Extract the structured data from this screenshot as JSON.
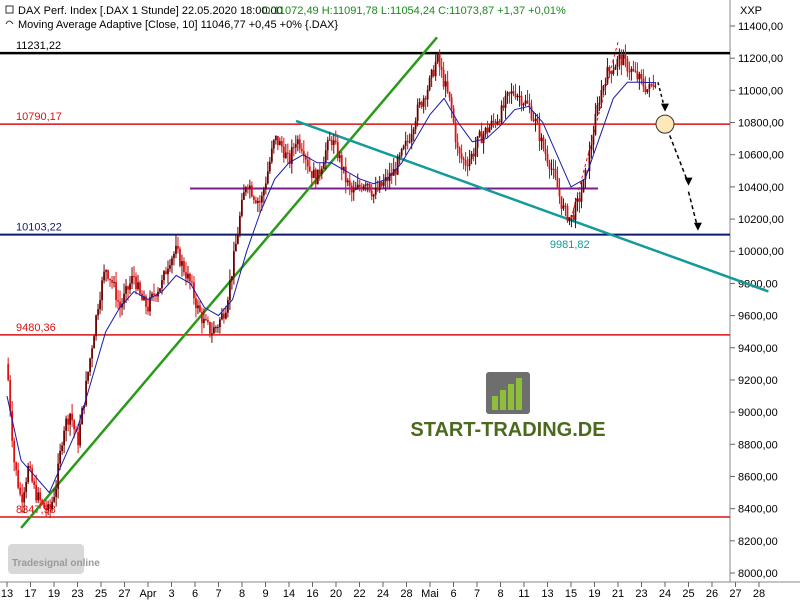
{
  "header": {
    "instrument": "DAX Perf. Index [.DAX  1 Stunde] 22.05.2020 18:00:00",
    "ohlc": "O:11072,49 H:11091,78 L:11054,24 C:11073,87 +1,37 +0,01%",
    "ma_label": "Moving Average Adaptive [Close, 10] 11046,77 +0,45 +0% {.DAX}",
    "axis_code": "XXP"
  },
  "watermark": {
    "brand": "START-TRADING.DE",
    "logo_text": "Tradesignal online"
  },
  "colors": {
    "candle_up": "#6b0000",
    "candle_down": "#e01010",
    "moving_average": "#1a1aa8",
    "resistance": "#000000",
    "red_level": "#dd1111",
    "purple_level": "#7a1d8a",
    "navy_level": "#0d1b6e",
    "uptrend": "#2a9a1a",
    "downtrend": "#139a9a",
    "brand_text": "#4b6a1e"
  },
  "chart_data": {
    "type": "candlestick",
    "y_axis": {
      "ylim": [
        7950,
        11550
      ],
      "ticks": [
        "8000,00",
        "8200,00",
        "8400,00",
        "8600,00",
        "8800,00",
        "9000,00",
        "9200,00",
        "9400,00",
        "9600,00",
        "9800,00",
        "10000,00",
        "10200,00",
        "10400,00",
        "10600,00",
        "10800,00",
        "11000,00",
        "11200,00",
        "11400,00"
      ]
    },
    "x_axis": {
      "tick_labels": [
        "13",
        "17",
        "19",
        "23",
        "25",
        "27",
        "Apr",
        "3",
        "6",
        "7",
        "8",
        "9",
        "14",
        "16",
        "20",
        "22",
        "24",
        "28",
        "Mai",
        "6",
        "7",
        "8",
        "11",
        "13",
        "15",
        "19",
        "21",
        "23",
        "24",
        "25",
        "26",
        "27",
        "28"
      ]
    },
    "horizontal_levels": [
      {
        "label": "11231,22",
        "value": 11231.22,
        "role": "resistance"
      },
      {
        "label": "10790,17",
        "value": 10790.17,
        "role": "red_level"
      },
      {
        "label": "",
        "value": 10390,
        "role": "purple_level"
      },
      {
        "label": "10103,22",
        "value": 10103.22,
        "role": "navy_level"
      },
      {
        "label": "9480,36",
        "value": 9480.36,
        "role": "red_level"
      },
      {
        "label": "8347,98",
        "value": 8347.98,
        "role": "red_level"
      }
    ],
    "trendlines": [
      {
        "role": "uptrend",
        "from": {
          "x": 0.6,
          "y": 8280
        },
        "to": {
          "x": 18.3,
          "y": 11330
        }
      },
      {
        "role": "downtrend",
        "from": {
          "x": 12.3,
          "y": 10810
        },
        "to": {
          "x": 32.4,
          "y": 9750
        }
      }
    ],
    "trendline_label": "9981,82",
    "close_path": [
      [
        0.0,
        9300
      ],
      [
        0.3,
        8700
      ],
      [
        0.6,
        8450
      ],
      [
        0.9,
        8650
      ],
      [
        1.2,
        8500
      ],
      [
        1.5,
        8420
      ],
      [
        1.8,
        8380
      ],
      [
        2.1,
        8550
      ],
      [
        2.4,
        8900
      ],
      [
        2.7,
        9000
      ],
      [
        3.0,
        8800
      ],
      [
        3.3,
        9100
      ],
      [
        3.6,
        9400
      ],
      [
        3.9,
        9700
      ],
      [
        4.2,
        9900
      ],
      [
        4.5,
        9800
      ],
      [
        4.8,
        9650
      ],
      [
        5.1,
        9750
      ],
      [
        5.4,
        9850
      ],
      [
        5.7,
        9700
      ],
      [
        6.0,
        9650
      ],
      [
        6.3,
        9750
      ],
      [
        6.6,
        9800
      ],
      [
        6.9,
        9950
      ],
      [
        7.2,
        10000
      ],
      [
        7.5,
        9900
      ],
      [
        7.8,
        9800
      ],
      [
        8.1,
        9650
      ],
      [
        8.4,
        9550
      ],
      [
        8.7,
        9500
      ],
      [
        9.0,
        9550
      ],
      [
        9.3,
        9650
      ],
      [
        9.6,
        9900
      ],
      [
        9.9,
        10200
      ],
      [
        10.2,
        10450
      ],
      [
        10.5,
        10350
      ],
      [
        10.8,
        10300
      ],
      [
        11.1,
        10500
      ],
      [
        11.4,
        10700
      ],
      [
        11.7,
        10650
      ],
      [
        12.0,
        10550
      ],
      [
        12.3,
        10700
      ],
      [
        12.6,
        10650
      ],
      [
        12.9,
        10500
      ],
      [
        13.2,
        10450
      ],
      [
        13.5,
        10600
      ],
      [
        13.8,
        10700
      ],
      [
        14.1,
        10600
      ],
      [
        14.4,
        10450
      ],
      [
        14.7,
        10350
      ],
      [
        15.0,
        10400
      ],
      [
        15.3,
        10450
      ],
      [
        15.6,
        10350
      ],
      [
        15.9,
        10400
      ],
      [
        16.2,
        10450
      ],
      [
        16.5,
        10500
      ],
      [
        16.8,
        10600
      ],
      [
        17.1,
        10700
      ],
      [
        17.4,
        10850
      ],
      [
        17.7,
        10950
      ],
      [
        18.0,
        11050
      ],
      [
        18.3,
        11200
      ],
      [
        18.6,
        11050
      ],
      [
        18.9,
        10900
      ],
      [
        19.2,
        10600
      ],
      [
        19.5,
        10550
      ],
      [
        19.8,
        10600
      ],
      [
        20.1,
        10700
      ],
      [
        20.4,
        10750
      ],
      [
        20.7,
        10800
      ],
      [
        21.0,
        10850
      ],
      [
        21.3,
        10950
      ],
      [
        21.6,
        11000
      ],
      [
        21.9,
        10950
      ],
      [
        22.2,
        10900
      ],
      [
        22.5,
        10800
      ],
      [
        22.8,
        10650
      ],
      [
        23.1,
        10550
      ],
      [
        23.4,
        10400
      ],
      [
        23.7,
        10250
      ],
      [
        24.0,
        10200
      ],
      [
        24.3,
        10300
      ],
      [
        24.6,
        10450
      ],
      [
        24.9,
        10700
      ],
      [
        25.2,
        10950
      ],
      [
        25.5,
        11100
      ],
      [
        25.8,
        11150
      ],
      [
        26.1,
        11200
      ],
      [
        26.4,
        11150
      ],
      [
        26.7,
        11100
      ],
      [
        27.0,
        11050
      ],
      [
        27.3,
        11000
      ],
      [
        27.6,
        11073.87
      ]
    ],
    "ma_path": [
      [
        0.0,
        9100
      ],
      [
        0.6,
        8700
      ],
      [
        1.2,
        8600
      ],
      [
        1.8,
        8500
      ],
      [
        2.4,
        8700
      ],
      [
        3.0,
        8900
      ],
      [
        3.6,
        9200
      ],
      [
        4.2,
        9500
      ],
      [
        4.8,
        9650
      ],
      [
        5.4,
        9750
      ],
      [
        6.0,
        9700
      ],
      [
        6.6,
        9750
      ],
      [
        7.2,
        9850
      ],
      [
        7.8,
        9800
      ],
      [
        8.4,
        9650
      ],
      [
        9.0,
        9600
      ],
      [
        9.6,
        9700
      ],
      [
        10.2,
        10000
      ],
      [
        10.8,
        10250
      ],
      [
        11.4,
        10450
      ],
      [
        12.0,
        10550
      ],
      [
        12.6,
        10600
      ],
      [
        13.2,
        10550
      ],
      [
        13.8,
        10550
      ],
      [
        14.4,
        10500
      ],
      [
        15.0,
        10450
      ],
      [
        15.6,
        10420
      ],
      [
        16.2,
        10450
      ],
      [
        16.8,
        10550
      ],
      [
        17.4,
        10700
      ],
      [
        18.0,
        10850
      ],
      [
        18.6,
        10950
      ],
      [
        19.2,
        10800
      ],
      [
        19.8,
        10680
      ],
      [
        20.4,
        10700
      ],
      [
        21.0,
        10780
      ],
      [
        21.6,
        10880
      ],
      [
        22.2,
        10900
      ],
      [
        22.8,
        10800
      ],
      [
        23.4,
        10600
      ],
      [
        24.0,
        10400
      ],
      [
        24.6,
        10450
      ],
      [
        25.2,
        10700
      ],
      [
        25.8,
        10950
      ],
      [
        26.4,
        11050
      ],
      [
        27.0,
        11050
      ],
      [
        27.6,
        11046.77
      ]
    ]
  }
}
